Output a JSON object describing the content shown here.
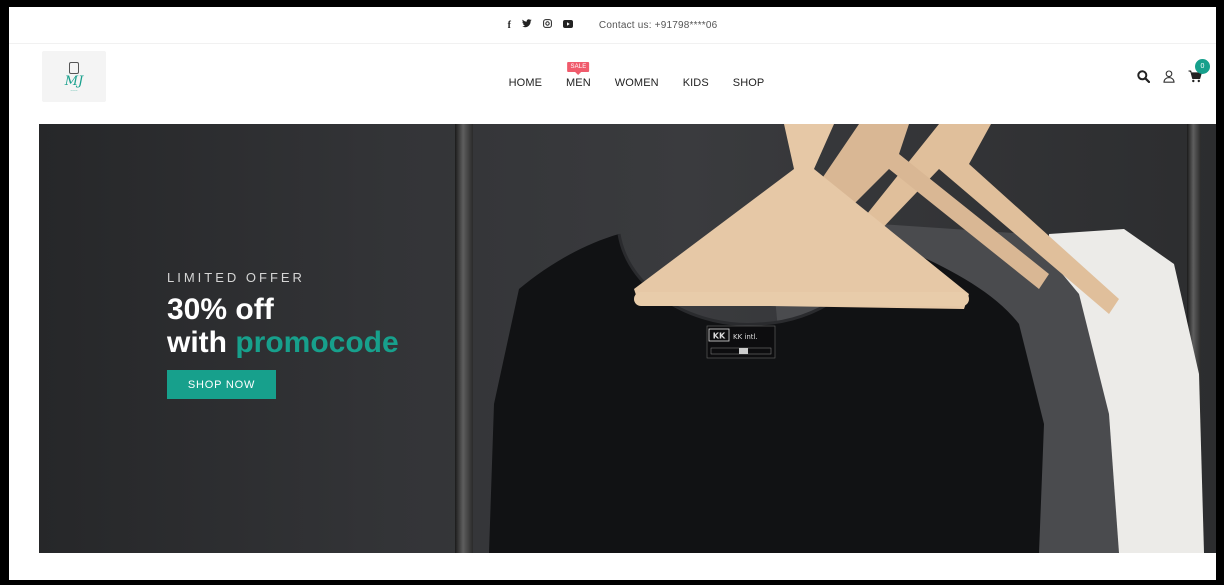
{
  "topbar": {
    "socials": [
      {
        "icon": "facebook-icon",
        "glyph": "f"
      },
      {
        "icon": "twitter-icon",
        "glyph": "🐦"
      },
      {
        "icon": "instagram-icon",
        "glyph": "◎"
      },
      {
        "icon": "youtube-icon",
        "glyph": "▶"
      }
    ],
    "contact": "Contact us: +91798****06"
  },
  "header": {
    "logo_text": "MJ",
    "nav": [
      {
        "label": "HOME"
      },
      {
        "label": "MEN",
        "badge": "SALE"
      },
      {
        "label": "WOMEN"
      },
      {
        "label": "KIDS"
      },
      {
        "label": "SHOP"
      }
    ],
    "cart_count": "0"
  },
  "hero": {
    "eyebrow": "LIMITED OFFER",
    "line1": "30% off",
    "line2_prefix": "with ",
    "line2_highlight": "promocode",
    "cta": "SHOP NOW",
    "tag_brand": "KK intl."
  },
  "colors": {
    "accent": "#17a08c",
    "sale_badge": "#f05b6c"
  }
}
